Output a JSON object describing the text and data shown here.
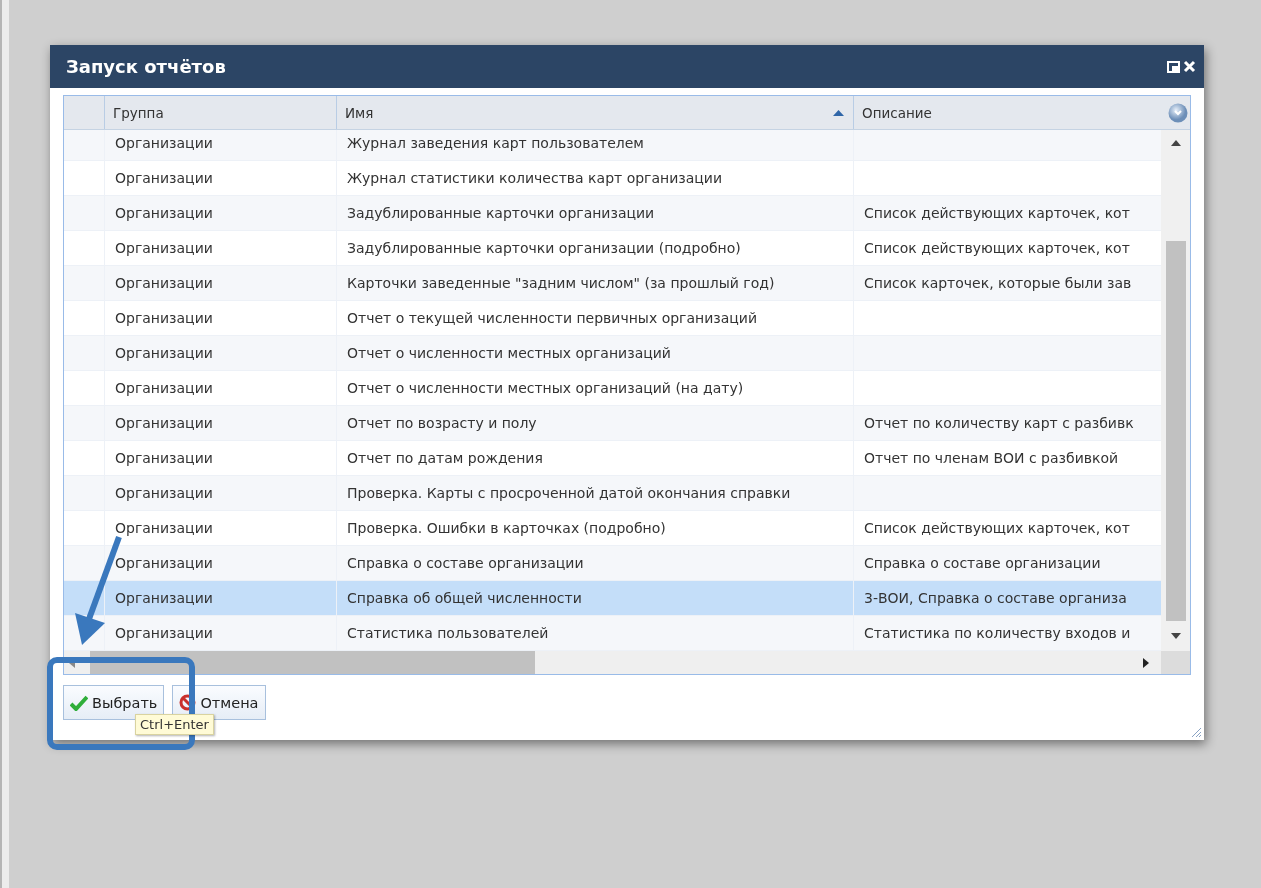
{
  "window": {
    "title": "Запуск отчётов"
  },
  "grid": {
    "columns": [
      {
        "label": "Группа",
        "sorted": false
      },
      {
        "label": "Имя",
        "sorted": true
      },
      {
        "label": "Описание",
        "sorted": false
      }
    ],
    "rows": [
      {
        "group": "Организации",
        "name": "Журнал заведения карт пользователем",
        "selected": false
      },
      {
        "group": "Организации",
        "name": "Журнал статистики количества карт организации",
        "selected": false
      },
      {
        "group": "Организации",
        "name": "Задублированные карточки организации",
        "description": "Список действующих карточек, кот",
        "selected": false
      },
      {
        "group": "Организации",
        "name": "Задублированные карточки организации (подробно)",
        "description": "Список действующих карточек, кот",
        "selected": false
      },
      {
        "group": "Организации",
        "name": "Карточки заведенные \"задним числом\" (за прошлый год)",
        "description": "Список карточек, которые были зав",
        "selected": false
      },
      {
        "group": "Организации",
        "name": "Отчет о текущей численности первичных организаций",
        "selected": false
      },
      {
        "group": "Организации",
        "name": "Отчет о численности местных организаций",
        "selected": false
      },
      {
        "group": "Организации",
        "name": "Отчет о численности местных организаций (на дату)",
        "selected": false
      },
      {
        "group": "Организации",
        "name": "Отчет по возрасту и полу",
        "description": "Отчет по количеству карт с разбивк",
        "selected": false
      },
      {
        "group": "Организации",
        "name": "Отчет по датам рождения",
        "description": "Отчет по членам ВОИ с разбивкой",
        "selected": false
      },
      {
        "group": "Организации",
        "name": "Проверка. Карты с просроченной датой окончания справки",
        "selected": false
      },
      {
        "group": "Организации",
        "name": "Проверка. Ошибки в карточках (подробно)",
        "description": "Список действующих карточек, кот",
        "selected": false
      },
      {
        "group": "Организации",
        "name": "Справка о составе организации",
        "description": "Справка о составе организации",
        "selected": false
      },
      {
        "group": "Организации",
        "name": "Справка об общей численности",
        "description": "3-ВОИ, Справка о составе организа",
        "selected": true
      },
      {
        "group": "Организации",
        "name": "Статистика пользователей",
        "description": "Статистика по количеству входов и",
        "selected": false
      }
    ]
  },
  "buttons": [
    {
      "label": "Выбрать",
      "kind": "confirm"
    },
    {
      "label": "Отмена",
      "kind": "cancel"
    }
  ],
  "tooltip": "Ctrl+Enter"
}
